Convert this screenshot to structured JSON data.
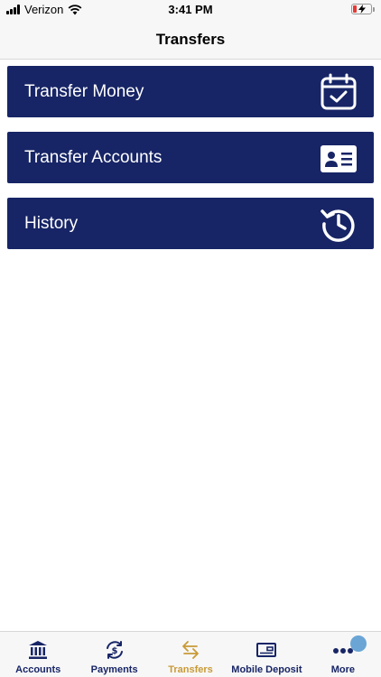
{
  "status_bar": {
    "carrier": "Verizon",
    "time": "3:41 PM"
  },
  "nav": {
    "title": "Transfers"
  },
  "menu": {
    "items": [
      {
        "label": "Transfer Money",
        "icon": "calendar-check-icon"
      },
      {
        "label": "Transfer Accounts",
        "icon": "id-card-icon"
      },
      {
        "label": "History",
        "icon": "history-clock-icon"
      }
    ]
  },
  "tabs": [
    {
      "label": "Accounts",
      "icon": "bank-icon"
    },
    {
      "label": "Payments",
      "icon": "dollar-cycle-icon"
    },
    {
      "label": "Transfers",
      "icon": "transfer-arrows-icon",
      "active": true
    },
    {
      "label": "Mobile Deposit",
      "icon": "check-deposit-icon"
    },
    {
      "label": "More",
      "icon": "more-dots-icon"
    }
  ],
  "colors": {
    "button_bg": "#172566",
    "tab_active": "#c99a36",
    "tab_inactive": "#172566",
    "badge": "#6aa5d6"
  }
}
